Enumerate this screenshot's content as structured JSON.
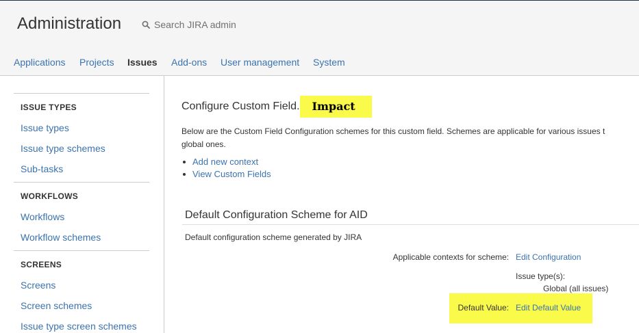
{
  "header": {
    "title": "Administration",
    "search_placeholder": "Search JIRA admin",
    "search_icon": "search-icon"
  },
  "nav": {
    "items": [
      {
        "label": "Applications",
        "active": false
      },
      {
        "label": "Projects",
        "active": false
      },
      {
        "label": "Issues",
        "active": true
      },
      {
        "label": "Add-ons",
        "active": false
      },
      {
        "label": "User management",
        "active": false
      },
      {
        "label": "System",
        "active": false
      }
    ]
  },
  "sidebar": {
    "sections": [
      {
        "heading": "ISSUE TYPES",
        "links": [
          "Issue types",
          "Issue type schemes",
          "Sub-tasks"
        ]
      },
      {
        "heading": "WORKFLOWS",
        "links": [
          "Workflows",
          "Workflow schemes"
        ]
      },
      {
        "heading": "SCREENS",
        "links": [
          "Screens",
          "Screen schemes",
          "Issue type screen schemes"
        ]
      }
    ]
  },
  "main": {
    "title_prefix": "Configure Custom Field.",
    "field_name": "Impact",
    "description_line1": "Below are the Custom Field Configuration schemes for this custom field. Schemes are applicable for various issues t",
    "description_line2": "global ones.",
    "actions": [
      "Add new context",
      "View Custom Fields"
    ],
    "scheme": {
      "title": "Default Configuration Scheme for AID",
      "description": "Default configuration scheme generated by JIRA",
      "contexts_label": "Applicable contexts for scheme:",
      "contexts_link": "Edit Configuration",
      "issue_types_label": "Issue type(s):",
      "issue_types_value": "Global (all issues)",
      "default_value_label": "Default Value:",
      "default_value_link": "Edit Default Value"
    }
  },
  "colors": {
    "link": "#3b73af",
    "highlight": "#fafa4b"
  }
}
